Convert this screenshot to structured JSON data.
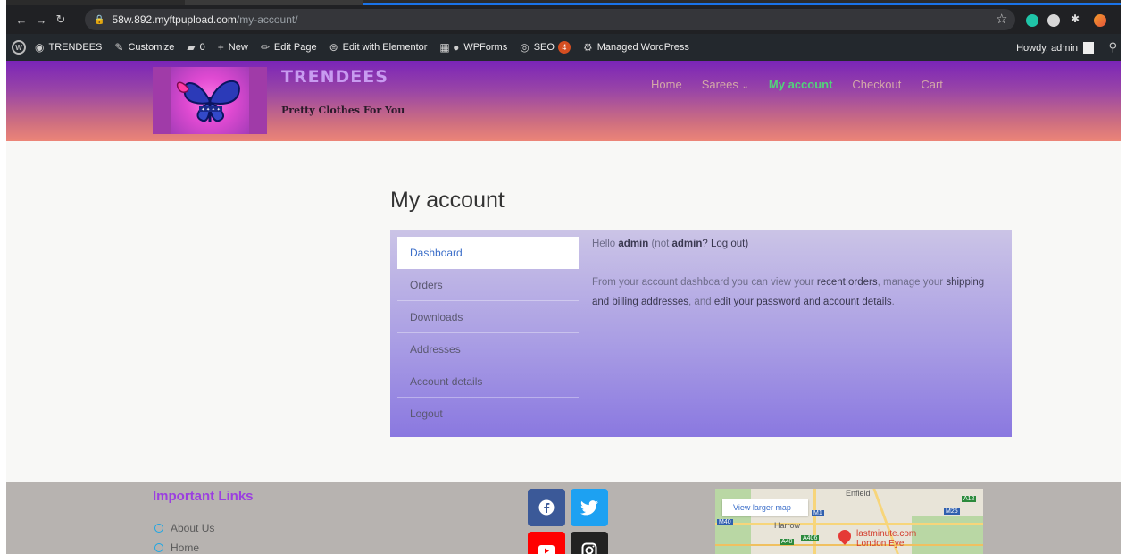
{
  "browser": {
    "url_host": "58w.892.myftpupload.com",
    "url_path": "/my-account/",
    "back_icon": "arrow-left-icon",
    "forward_icon": "arrow-right-icon",
    "reload_icon": "reload-icon"
  },
  "admin_bar": {
    "site_name": "TRENDEES",
    "customize": "Customize",
    "comments_count": "0",
    "new": "New",
    "edit_page": "Edit Page",
    "edit_elementor": "Edit with Elementor",
    "wpforms": "WPForms",
    "seo": "SEO",
    "seo_badge": "4",
    "managed": "Managed WordPress",
    "howdy": "Howdy, admin"
  },
  "header": {
    "site_title": "TRENDEES",
    "tagline": "Pretty Clothes For You",
    "menu": [
      {
        "label": "Home",
        "active": false
      },
      {
        "label": "Sarees",
        "active": false
      },
      {
        "label": "My account",
        "active": true
      },
      {
        "label": "Checkout",
        "active": false
      },
      {
        "label": "Cart",
        "active": false
      }
    ],
    "sarees_caret": "⌄"
  },
  "main": {
    "title": "My account",
    "nav": [
      {
        "label": "Dashboard",
        "active": true
      },
      {
        "label": "Orders"
      },
      {
        "label": "Downloads"
      },
      {
        "label": "Addresses"
      },
      {
        "label": "Account details"
      },
      {
        "label": "Logout"
      }
    ],
    "hello_prefix": "Hello ",
    "hello_user": "admin",
    "hello_mid": " (not ",
    "hello_user2": "admin",
    "hello_q": "? ",
    "logout_link": "Log out",
    "hello_end": ")",
    "desc_1": "From your account dashboard you can view your ",
    "link_orders": "recent orders",
    "desc_2": ", manage your ",
    "link_addresses": "shipping and billing addresses",
    "desc_3": ", and ",
    "link_details": "edit your password and account details",
    "desc_4": "."
  },
  "footer": {
    "heading": "Important Links",
    "links": [
      "About Us",
      "Home"
    ],
    "map_button": "View larger map",
    "map_labels": {
      "enfield": "Enfield",
      "harrow": "Harrow",
      "place_1": "lastminute.com",
      "place_2": "London Eye"
    },
    "map_shields": {
      "m1": "M1",
      "m25": "M25",
      "a12": "A12",
      "m40": "M40",
      "a40": "A40",
      "a406": "A406"
    },
    "colors": {
      "facebook": "#3b5998",
      "twitter": "#1da1f2",
      "youtube": "#ff0000",
      "instagram": "#222222"
    }
  }
}
